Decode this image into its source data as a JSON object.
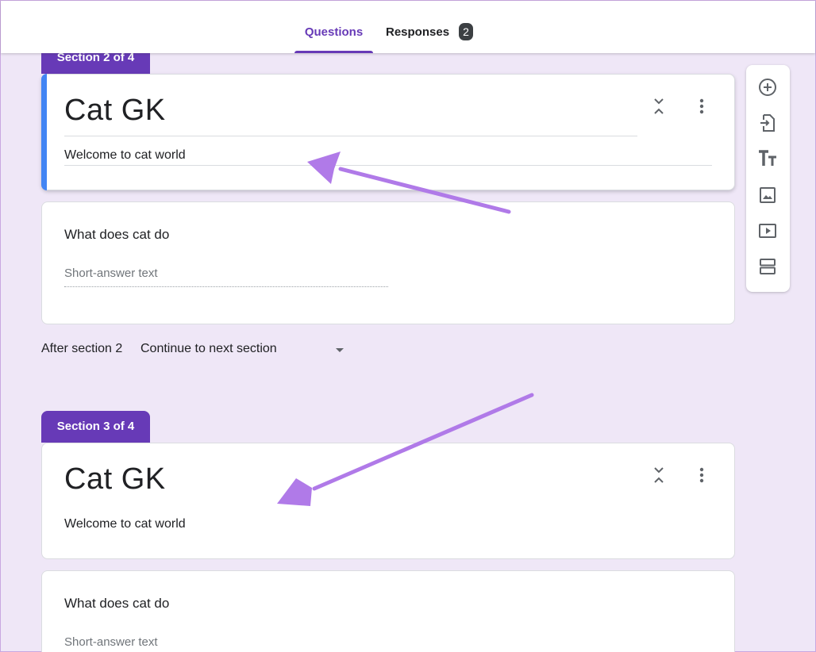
{
  "tabs": {
    "questions": "Questions",
    "responses": "Responses",
    "responses_count": "2"
  },
  "sections": [
    {
      "tab_label": "Section 2 of 4",
      "title": "Cat GK",
      "description": "Welcome to cat world",
      "question": "What does cat do",
      "answer_placeholder": "Short-answer text",
      "after_label": "After section 2",
      "after_value": "Continue to next section"
    },
    {
      "tab_label": "Section 3 of 4",
      "title": "Cat GK",
      "description": "Welcome to cat world",
      "question": "What does cat do",
      "answer_placeholder": "Short-answer text"
    }
  ],
  "toolbar": [
    "add-question-icon",
    "import-questions-icon",
    "title-text-icon",
    "image-icon",
    "video-icon",
    "section-icon"
  ],
  "colors": {
    "accent": "#673ab7",
    "active_bar": "#4285f4",
    "page_bg": "#efe7f7",
    "annotation_arrow": "#b07ae8"
  }
}
